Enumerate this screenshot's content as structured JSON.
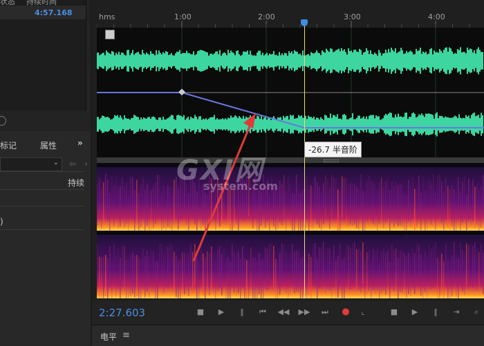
{
  "left_panel": {
    "header_col1": "状态",
    "header_col2": "持续时间",
    "duration_value": "4:57.168",
    "tab_markers": "标记",
    "tab_properties": "属性",
    "expand_glyph": "»",
    "col_duration": "持续",
    "paren": ")"
  },
  "ruler": {
    "unit": "hms",
    "labels": [
      "1:00",
      "2:00",
      "3:00",
      "4:00"
    ]
  },
  "tooltip": "-26.7 半音阶",
  "watermark": {
    "main": "GXI网",
    "sub": "system.com"
  },
  "transport": {
    "time": "2:27.603",
    "accent": "#4a8fe0",
    "record_color": "#e23b3b"
  },
  "bottom": {
    "label": "电平",
    "menu_glyph": "≡"
  },
  "colors": {
    "waveform": "#3ed6a0",
    "envelope": "#6a78e0",
    "arrow": "#e03a3a"
  }
}
